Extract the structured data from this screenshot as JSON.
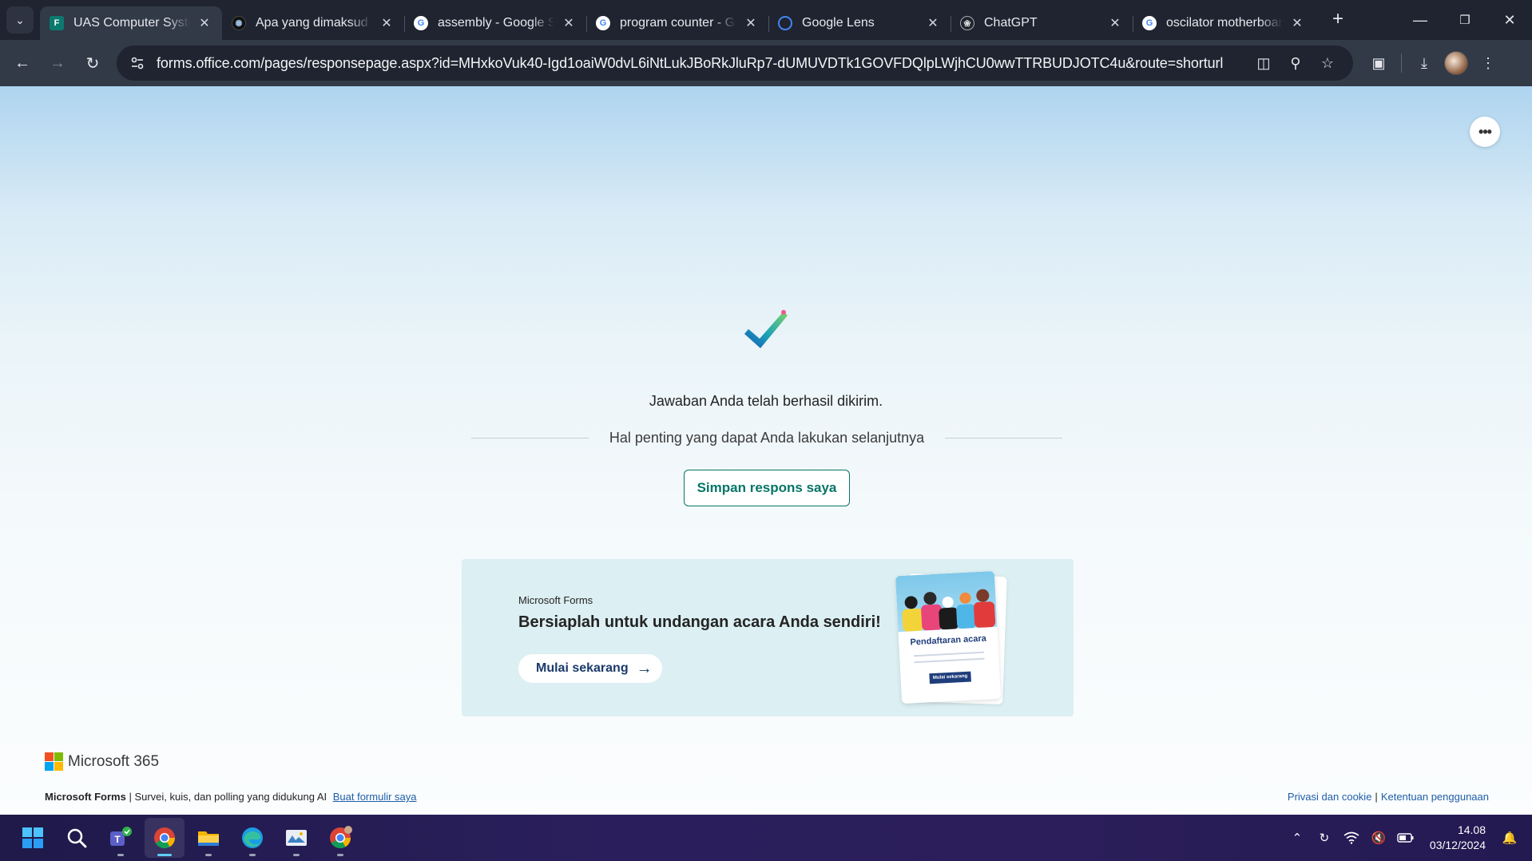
{
  "browser": {
    "tabs": [
      {
        "title": "UAS Computer System",
        "favicon": "forms-icon",
        "active": true
      },
      {
        "title": "Apa yang dimaksud dengan",
        "favicon": "perplexity-icon",
        "active": false
      },
      {
        "title": "assembly - Google Search",
        "favicon": "google-icon",
        "active": false
      },
      {
        "title": "program counter - Google",
        "favicon": "google-icon",
        "active": false
      },
      {
        "title": "Google Lens",
        "favicon": "lens-icon",
        "active": false
      },
      {
        "title": "ChatGPT",
        "favicon": "chatgpt-icon",
        "active": false
      },
      {
        "title": "oscilator motherboard",
        "favicon": "google-icon",
        "active": false
      }
    ],
    "url": "forms.office.com/pages/responsepage.aspx?id=MHxkoVuk40-Igd1oaiW0dvL6iNtLukJBoRkJluRp7-dUMUVDTk1GOVFDQlpLWjhCU0wwTTRBUDJOTC4u&route=shorturl"
  },
  "page": {
    "success_message": "Jawaban Anda telah berhasil dikirim.",
    "next_steps_heading": "Hal penting yang dapat Anda lakukan selanjutnya",
    "save_button": "Simpan respons saya",
    "promo": {
      "eyebrow": "Microsoft Forms",
      "title": "Bersiaplah untuk undangan acara Anda sendiri!",
      "cta": "Mulai sekarang",
      "card_title": "Pendaftaran acara",
      "card_button": "Mulai sekarang"
    },
    "brand": "Microsoft 365",
    "footer": {
      "product": "Microsoft Forms",
      "tagline": " | Survei, kuis, dan polling yang didukung AI",
      "create_link": "Buat formulir saya",
      "privacy": "Privasi dan cookie",
      "separator": "|",
      "terms": "Ketentuan penggunaan"
    }
  },
  "taskbar": {
    "apps": [
      "windows-start-icon",
      "search-icon",
      "teams-icon",
      "chrome-icon",
      "file-explorer-icon",
      "edge-icon",
      "photos-icon",
      "chrome-profile-icon"
    ],
    "time": "14.08",
    "date": "03/12/2024"
  },
  "colors": {
    "accent": "#077568",
    "link": "#1e5ea8",
    "promo_bg": "#dceff2"
  }
}
